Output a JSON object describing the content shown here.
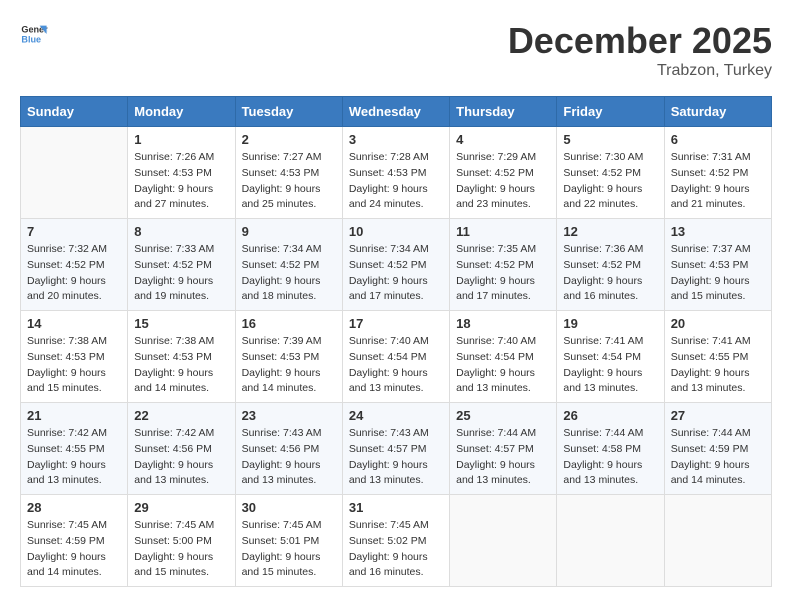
{
  "header": {
    "logo_general": "General",
    "logo_blue": "Blue",
    "month": "December 2025",
    "location": "Trabzon, Turkey"
  },
  "days_of_week": [
    "Sunday",
    "Monday",
    "Tuesday",
    "Wednesday",
    "Thursday",
    "Friday",
    "Saturday"
  ],
  "weeks": [
    [
      {
        "num": "",
        "sunrise": "",
        "sunset": "",
        "daylight": ""
      },
      {
        "num": "1",
        "sunrise": "Sunrise: 7:26 AM",
        "sunset": "Sunset: 4:53 PM",
        "daylight": "Daylight: 9 hours and 27 minutes."
      },
      {
        "num": "2",
        "sunrise": "Sunrise: 7:27 AM",
        "sunset": "Sunset: 4:53 PM",
        "daylight": "Daylight: 9 hours and 25 minutes."
      },
      {
        "num": "3",
        "sunrise": "Sunrise: 7:28 AM",
        "sunset": "Sunset: 4:53 PM",
        "daylight": "Daylight: 9 hours and 24 minutes."
      },
      {
        "num": "4",
        "sunrise": "Sunrise: 7:29 AM",
        "sunset": "Sunset: 4:52 PM",
        "daylight": "Daylight: 9 hours and 23 minutes."
      },
      {
        "num": "5",
        "sunrise": "Sunrise: 7:30 AM",
        "sunset": "Sunset: 4:52 PM",
        "daylight": "Daylight: 9 hours and 22 minutes."
      },
      {
        "num": "6",
        "sunrise": "Sunrise: 7:31 AM",
        "sunset": "Sunset: 4:52 PM",
        "daylight": "Daylight: 9 hours and 21 minutes."
      }
    ],
    [
      {
        "num": "7",
        "sunrise": "Sunrise: 7:32 AM",
        "sunset": "Sunset: 4:52 PM",
        "daylight": "Daylight: 9 hours and 20 minutes."
      },
      {
        "num": "8",
        "sunrise": "Sunrise: 7:33 AM",
        "sunset": "Sunset: 4:52 PM",
        "daylight": "Daylight: 9 hours and 19 minutes."
      },
      {
        "num": "9",
        "sunrise": "Sunrise: 7:34 AM",
        "sunset": "Sunset: 4:52 PM",
        "daylight": "Daylight: 9 hours and 18 minutes."
      },
      {
        "num": "10",
        "sunrise": "Sunrise: 7:34 AM",
        "sunset": "Sunset: 4:52 PM",
        "daylight": "Daylight: 9 hours and 17 minutes."
      },
      {
        "num": "11",
        "sunrise": "Sunrise: 7:35 AM",
        "sunset": "Sunset: 4:52 PM",
        "daylight": "Daylight: 9 hours and 17 minutes."
      },
      {
        "num": "12",
        "sunrise": "Sunrise: 7:36 AM",
        "sunset": "Sunset: 4:52 PM",
        "daylight": "Daylight: 9 hours and 16 minutes."
      },
      {
        "num": "13",
        "sunrise": "Sunrise: 7:37 AM",
        "sunset": "Sunset: 4:53 PM",
        "daylight": "Daylight: 9 hours and 15 minutes."
      }
    ],
    [
      {
        "num": "14",
        "sunrise": "Sunrise: 7:38 AM",
        "sunset": "Sunset: 4:53 PM",
        "daylight": "Daylight: 9 hours and 15 minutes."
      },
      {
        "num": "15",
        "sunrise": "Sunrise: 7:38 AM",
        "sunset": "Sunset: 4:53 PM",
        "daylight": "Daylight: 9 hours and 14 minutes."
      },
      {
        "num": "16",
        "sunrise": "Sunrise: 7:39 AM",
        "sunset": "Sunset: 4:53 PM",
        "daylight": "Daylight: 9 hours and 14 minutes."
      },
      {
        "num": "17",
        "sunrise": "Sunrise: 7:40 AM",
        "sunset": "Sunset: 4:54 PM",
        "daylight": "Daylight: 9 hours and 13 minutes."
      },
      {
        "num": "18",
        "sunrise": "Sunrise: 7:40 AM",
        "sunset": "Sunset: 4:54 PM",
        "daylight": "Daylight: 9 hours and 13 minutes."
      },
      {
        "num": "19",
        "sunrise": "Sunrise: 7:41 AM",
        "sunset": "Sunset: 4:54 PM",
        "daylight": "Daylight: 9 hours and 13 minutes."
      },
      {
        "num": "20",
        "sunrise": "Sunrise: 7:41 AM",
        "sunset": "Sunset: 4:55 PM",
        "daylight": "Daylight: 9 hours and 13 minutes."
      }
    ],
    [
      {
        "num": "21",
        "sunrise": "Sunrise: 7:42 AM",
        "sunset": "Sunset: 4:55 PM",
        "daylight": "Daylight: 9 hours and 13 minutes."
      },
      {
        "num": "22",
        "sunrise": "Sunrise: 7:42 AM",
        "sunset": "Sunset: 4:56 PM",
        "daylight": "Daylight: 9 hours and 13 minutes."
      },
      {
        "num": "23",
        "sunrise": "Sunrise: 7:43 AM",
        "sunset": "Sunset: 4:56 PM",
        "daylight": "Daylight: 9 hours and 13 minutes."
      },
      {
        "num": "24",
        "sunrise": "Sunrise: 7:43 AM",
        "sunset": "Sunset: 4:57 PM",
        "daylight": "Daylight: 9 hours and 13 minutes."
      },
      {
        "num": "25",
        "sunrise": "Sunrise: 7:44 AM",
        "sunset": "Sunset: 4:57 PM",
        "daylight": "Daylight: 9 hours and 13 minutes."
      },
      {
        "num": "26",
        "sunrise": "Sunrise: 7:44 AM",
        "sunset": "Sunset: 4:58 PM",
        "daylight": "Daylight: 9 hours and 13 minutes."
      },
      {
        "num": "27",
        "sunrise": "Sunrise: 7:44 AM",
        "sunset": "Sunset: 4:59 PM",
        "daylight": "Daylight: 9 hours and 14 minutes."
      }
    ],
    [
      {
        "num": "28",
        "sunrise": "Sunrise: 7:45 AM",
        "sunset": "Sunset: 4:59 PM",
        "daylight": "Daylight: 9 hours and 14 minutes."
      },
      {
        "num": "29",
        "sunrise": "Sunrise: 7:45 AM",
        "sunset": "Sunset: 5:00 PM",
        "daylight": "Daylight: 9 hours and 15 minutes."
      },
      {
        "num": "30",
        "sunrise": "Sunrise: 7:45 AM",
        "sunset": "Sunset: 5:01 PM",
        "daylight": "Daylight: 9 hours and 15 minutes."
      },
      {
        "num": "31",
        "sunrise": "Sunrise: 7:45 AM",
        "sunset": "Sunset: 5:02 PM",
        "daylight": "Daylight: 9 hours and 16 minutes."
      },
      {
        "num": "",
        "sunrise": "",
        "sunset": "",
        "daylight": ""
      },
      {
        "num": "",
        "sunrise": "",
        "sunset": "",
        "daylight": ""
      },
      {
        "num": "",
        "sunrise": "",
        "sunset": "",
        "daylight": ""
      }
    ]
  ]
}
